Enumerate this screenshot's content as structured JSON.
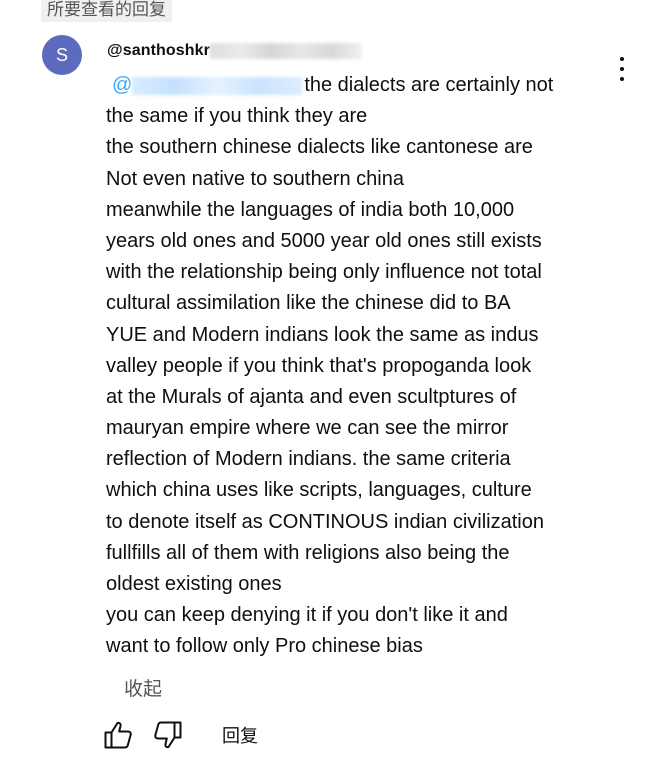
{
  "header": {
    "label": "所要查看的回复"
  },
  "comment": {
    "avatar_letter": "S",
    "username": "@santhoshkr",
    "mention_prefix": "@",
    "lines": [
      "the dialects are certainly not",
      "the same if you think they are",
      "the southern chinese dialects like cantonese are",
      "Not even native to southern china",
      "meanwhile the languages of india both 10,000",
      "years old ones and 5000 year old ones still exists",
      "with the relationship being only influence not total",
      "cultural assimilation like the chinese did to BA",
      "YUE and Modern indians look the same as indus",
      "valley people if you think that's propoganda look",
      "at the Murals of ajanta and even scultptures of",
      "mauryan empire where we can see the mirror",
      "reflection of Modern indians. the same criteria",
      "which china uses like scripts, languages, culture",
      "to denote itself as CONTINOUS  indian civilization",
      "fullfills all of them with religions also being the",
      "oldest  existing ones",
      "you can keep denying it if you don't like it and",
      "want to follow only  Pro chinese bias"
    ],
    "collapse_label": "收起",
    "reply_label": "回复"
  },
  "icons": {
    "menu": "more-vert-icon",
    "like": "thumb-up-icon",
    "dislike": "thumb-down-icon"
  },
  "colors": {
    "avatar_bg": "#5c6bc0",
    "mention": "#3ea6ff",
    "text": "#0f0f0f",
    "muted": "#555555"
  }
}
